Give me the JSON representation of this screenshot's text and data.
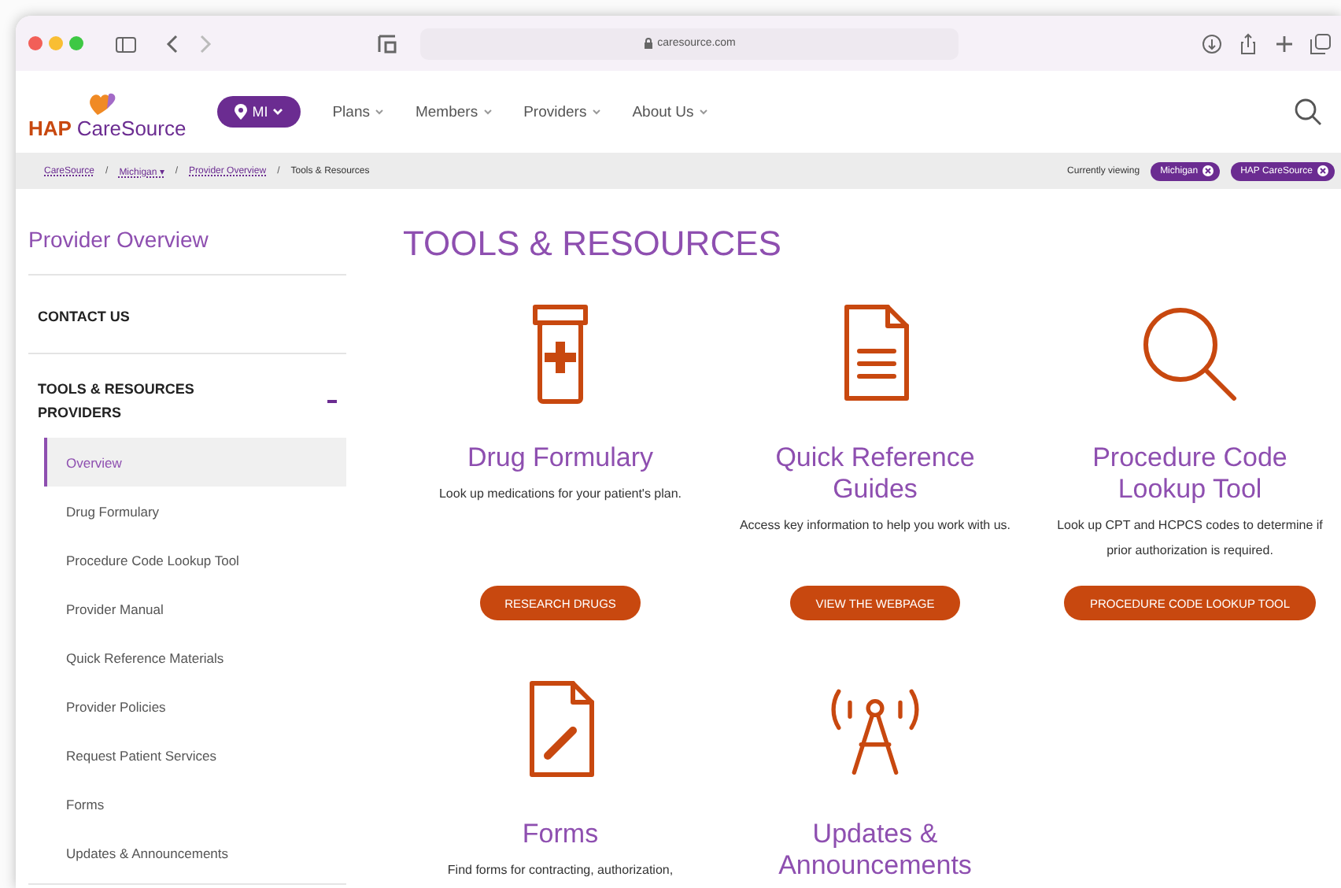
{
  "browser": {
    "url": "caresource.com"
  },
  "header": {
    "logo": {
      "brand_a": "HAP",
      "brand_b": "CareSource"
    },
    "state_pill": "MI",
    "nav": [
      "Plans",
      "Members",
      "Providers",
      "About Us"
    ]
  },
  "breadcrumb": {
    "separator": "/",
    "items": [
      {
        "label": "CareSource"
      },
      {
        "label": "Michigan",
        "caret": "▾"
      },
      {
        "label": "Provider Overview"
      },
      {
        "label": "Tools & Resources"
      }
    ],
    "viewing_label": "Currently viewing",
    "viewing_pills": [
      "Michigan",
      "HAP CareSource"
    ]
  },
  "sidebar": {
    "title": "Provider Overview",
    "sections": [
      {
        "label": "CONTACT US",
        "expanded": false
      },
      {
        "label": "TOOLS & RESOURCES PROVIDERS",
        "expanded": true,
        "children": [
          {
            "label": "Overview",
            "selected": true
          },
          {
            "label": "Drug Formulary",
            "selected": false
          },
          {
            "label": "Procedure Code Lookup Tool",
            "selected": false
          },
          {
            "label": "Provider Manual",
            "selected": false
          },
          {
            "label": "Quick Reference Materials",
            "selected": false
          },
          {
            "label": "Provider Policies",
            "selected": false
          },
          {
            "label": "Request Patient Services",
            "selected": false
          },
          {
            "label": "Forms",
            "selected": false
          },
          {
            "label": "Updates & Announcements",
            "selected": false
          }
        ]
      }
    ]
  },
  "page_title": "TOOLS & RESOURCES",
  "cards": [
    {
      "kind": "bottle",
      "title": "Drug Formulary",
      "text": "Look up medications for your patient's plan.",
      "button": "RESEARCH DRUGS"
    },
    {
      "kind": "document",
      "title": "Quick Reference Guides",
      "text": "Access key information to help you work with us.",
      "button": "VIEW THE WEBPAGE"
    },
    {
      "kind": "search",
      "title": "Procedure Code Lookup Tool",
      "text": "Look up CPT and HCPCS codes to determine if prior authorization is required.",
      "button": "PROCEDURE CODE LOOKUP TOOL"
    },
    {
      "kind": "form",
      "title": "Forms",
      "text": "Find forms for contracting, authorization,"
    },
    {
      "kind": "antenna",
      "title": "Updates & Announcements"
    }
  ]
}
